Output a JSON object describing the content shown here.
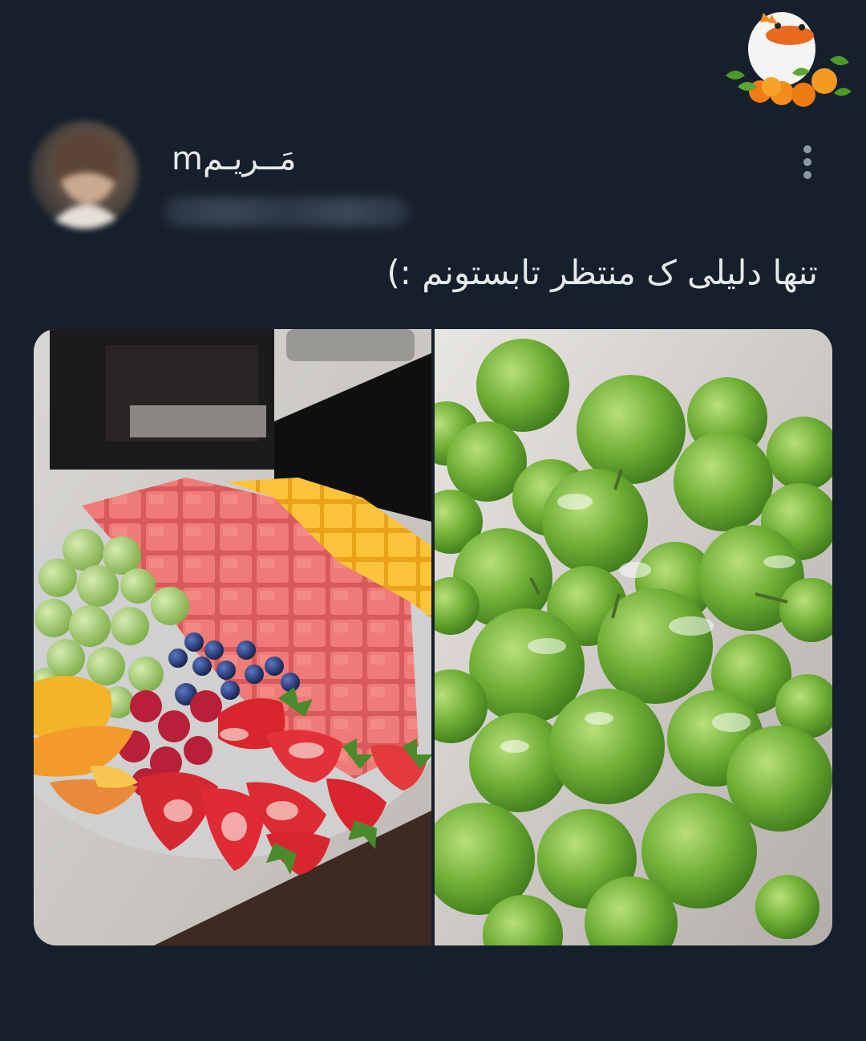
{
  "tweet": {
    "display_name": "مَــریـمm",
    "handle": "@•••••••",
    "text": "تنها دلیلی ک منتظر تابستونم :)"
  },
  "media": [
    {
      "name": "fruit-platter-photo"
    },
    {
      "name": "green-plums-photo"
    }
  ],
  "icons": {
    "more": "more-vertical-icon",
    "sticker": "duck-orange-sticker-icon"
  },
  "colors": {
    "background": "#16202c",
    "text": "#e7e9ea",
    "muted": "#8b98a5"
  }
}
